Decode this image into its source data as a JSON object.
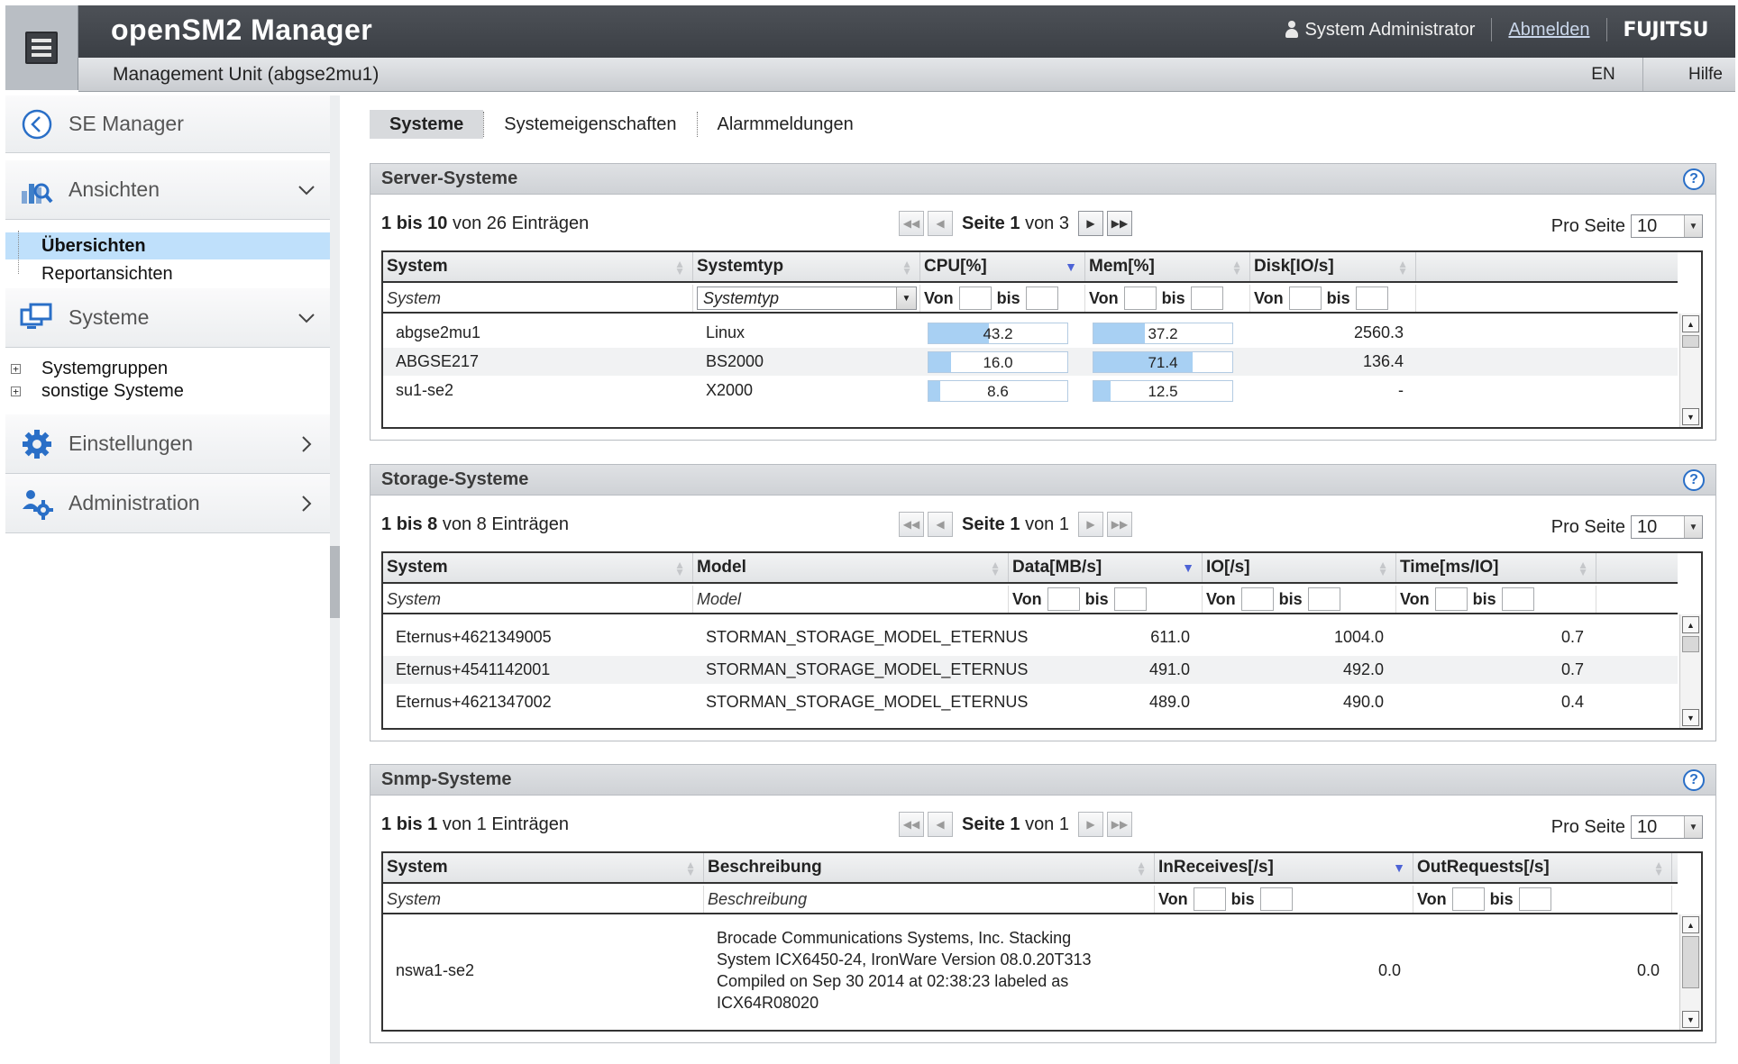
{
  "header": {
    "app_title": "openSM2 Manager",
    "user_name": "System Administrator",
    "logout_label": "Abmelden",
    "brand": "FUJITSU",
    "unit_label": "Management Unit (abgse2mu1)",
    "language": "EN",
    "help_label": "Hilfe"
  },
  "sidebar": {
    "back_label": "SE Manager",
    "sections": [
      {
        "label": "Ansichten",
        "icon": "chart-search-icon",
        "expanded": true
      },
      {
        "label": "Systeme",
        "icon": "monitor-icon",
        "expanded": true
      },
      {
        "label": "Einstellungen",
        "icon": "gear-icon",
        "expanded": false
      },
      {
        "label": "Administration",
        "icon": "admin-gears-icon",
        "expanded": false
      }
    ],
    "ansichten_items": [
      "Übersichten",
      "Reportansichten"
    ],
    "systeme_items": [
      "Systemgruppen",
      "sonstige Systeme"
    ]
  },
  "tabs": [
    "Systeme",
    "Systemeigenschaften",
    "Alarmmeldungen"
  ],
  "pager": {
    "page_word": "Seite",
    "of_word": "von",
    "per_page_label": "Pro Seite",
    "per_page_value": "10",
    "entries_word": "Einträgen",
    "to_word": "bis",
    "from_word": "von"
  },
  "filters": {
    "from": "Von",
    "to": "bis"
  },
  "server": {
    "title": "Server-Systeme",
    "range_start": "1",
    "range_end": "10",
    "total": "26",
    "page": "1",
    "pages": "3",
    "columns": [
      "System",
      "Systemtyp",
      "CPU[%]",
      "Mem[%]",
      "Disk[IO/s]"
    ],
    "filter_system": "System",
    "filter_type": "Systemtyp",
    "rows": [
      {
        "system": "abgse2mu1",
        "type": "Linux",
        "cpu": "43.2",
        "cpu_frac": 0.432,
        "mem": "37.2",
        "mem_frac": 0.372,
        "disk": "2560.3"
      },
      {
        "system": "ABGSE217",
        "type": "BS2000",
        "cpu": "16.0",
        "cpu_frac": 0.16,
        "mem": "71.4",
        "mem_frac": 0.714,
        "disk": "136.4"
      },
      {
        "system": "su1-se2",
        "type": "X2000",
        "cpu": "8.6",
        "cpu_frac": 0.086,
        "mem": "12.5",
        "mem_frac": 0.125,
        "disk": "-"
      }
    ]
  },
  "storage": {
    "title": "Storage-Systeme",
    "range_start": "1",
    "range_end": "8",
    "total": "8",
    "page": "1",
    "pages": "1",
    "columns": [
      "System",
      "Model",
      "Data[MB/s]",
      "IO[/s]",
      "Time[ms/IO]"
    ],
    "filter_system": "System",
    "filter_model": "Model",
    "rows": [
      {
        "system": "Eternus+4621349005",
        "model": "STORMAN_STORAGE_MODEL_ETERNUS",
        "data": "611.0",
        "io": "1004.0",
        "time": "0.7"
      },
      {
        "system": "Eternus+4541142001",
        "model": "STORMAN_STORAGE_MODEL_ETERNUS",
        "data": "491.0",
        "io": "492.0",
        "time": "0.7"
      },
      {
        "system": "Eternus+4621347002",
        "model": "STORMAN_STORAGE_MODEL_ETERNUS",
        "data": "489.0",
        "io": "490.0",
        "time": "0.4"
      }
    ]
  },
  "snmp": {
    "title": "Snmp-Systeme",
    "range_start": "1",
    "range_end": "1",
    "total": "1",
    "page": "1",
    "pages": "1",
    "columns": [
      "System",
      "Beschreibung",
      "InReceives[/s]",
      "OutRequests[/s]"
    ],
    "filter_system": "System",
    "filter_desc": "Beschreibung",
    "rows": [
      {
        "system": "nswa1-se2",
        "desc_lines": [
          "Brocade Communications Systems, Inc. Stacking",
          "System ICX6450-24, IronWare Version 08.0.20T313",
          "Compiled on Sep 30 2014 at 02:38:23 labeled as",
          "ICX64R08020"
        ],
        "in": "0.0",
        "out": "0.0"
      }
    ]
  },
  "colors": {
    "accent": "#a8d0f3",
    "selection": "#bfe0fb",
    "header_dark": "#3b3f45"
  }
}
